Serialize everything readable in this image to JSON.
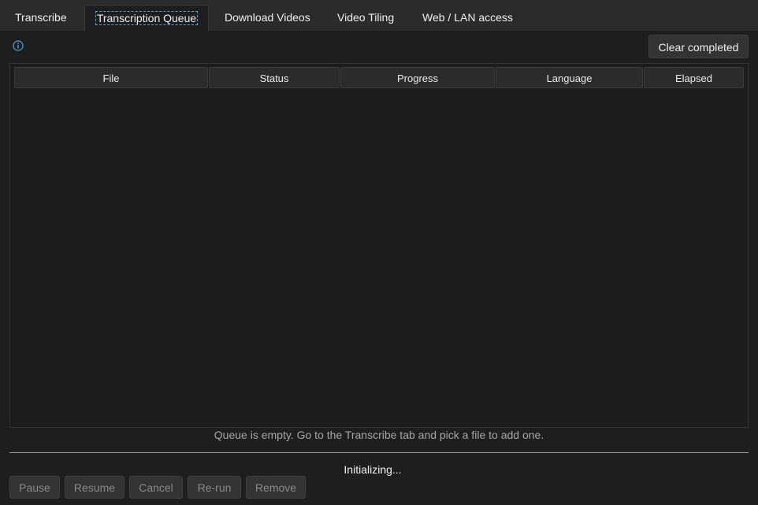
{
  "tabs": [
    {
      "label": "Transcribe",
      "active": false
    },
    {
      "label": "Transcription Queue",
      "active": true
    },
    {
      "label": "Download Videos",
      "active": false
    },
    {
      "label": "Video Tiling",
      "active": false
    },
    {
      "label": "Web / LAN access",
      "active": false
    }
  ],
  "toolbar": {
    "info_icon": "info-circle-icon",
    "clear_label": "Clear completed"
  },
  "table": {
    "columns": [
      "File",
      "Status",
      "Progress",
      "Language",
      "Elapsed"
    ],
    "rows": []
  },
  "empty_message": "Queue is empty.  Go to the Transcribe tab and pick a file to add one.",
  "status": "Initializing...",
  "actions": {
    "pause": "Pause",
    "resume": "Resume",
    "cancel": "Cancel",
    "rerun": "Re-run",
    "remove": "Remove",
    "enabled": false
  },
  "colors": {
    "background": "#1e1e1e",
    "tab_bar": "#2b2b2b",
    "accent": "#4aa3df",
    "disabled_text": "#8a8a8a"
  }
}
